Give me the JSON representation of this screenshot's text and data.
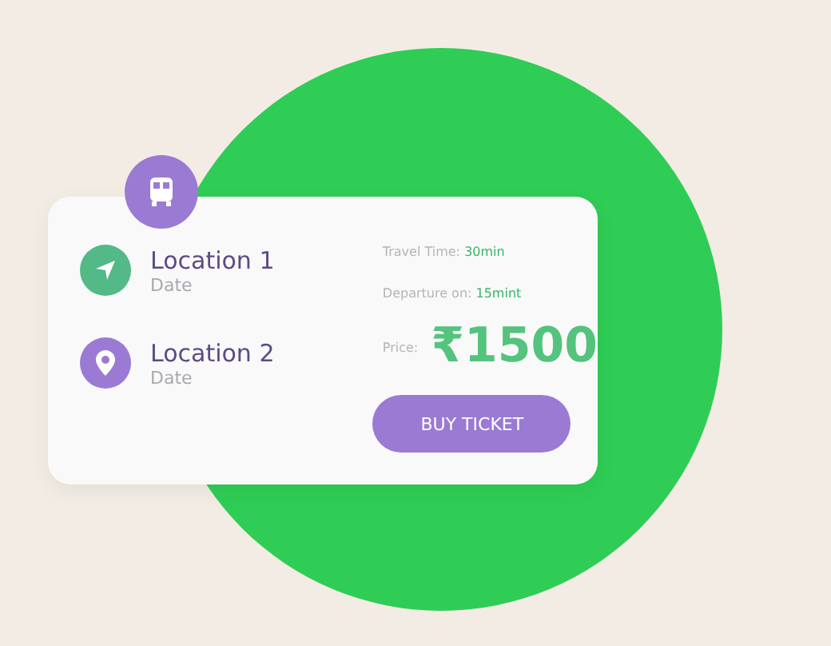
{
  "stops": [
    {
      "kind": "origin",
      "name": "Location 1",
      "date": "Date"
    },
    {
      "kind": "destination",
      "name": "Location 2",
      "date": "Date"
    }
  ],
  "details": [
    {
      "label": "Travel Time:",
      "value": "30min"
    },
    {
      "label": "Departure on:",
      "value": "15mint"
    }
  ],
  "price": {
    "label": "Price:",
    "value": "₹1500"
  },
  "button": "BUY TICKET"
}
